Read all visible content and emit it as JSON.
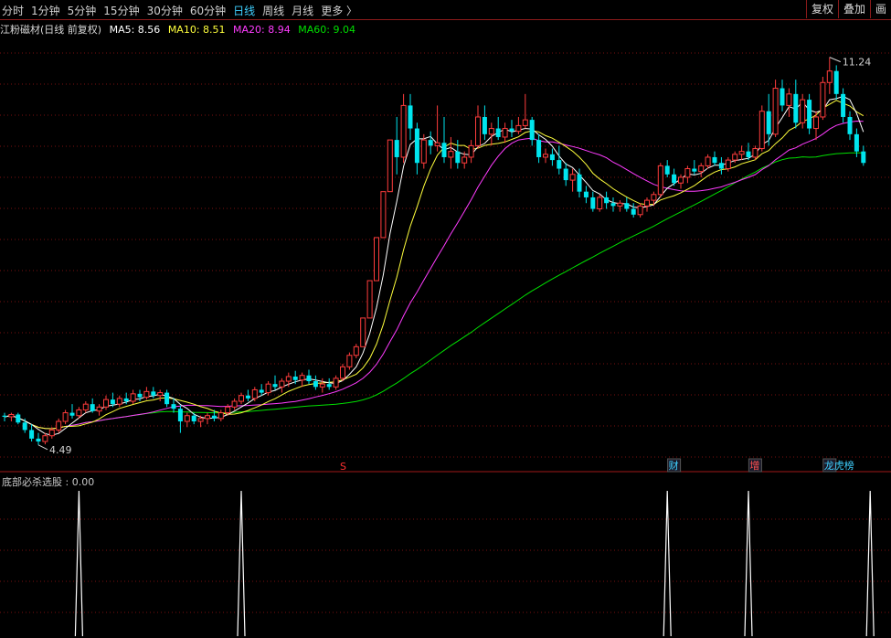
{
  "toolbar": {
    "periods": [
      {
        "label": "分时",
        "active": false
      },
      {
        "label": "1分钟",
        "active": false
      },
      {
        "label": "5分钟",
        "active": false
      },
      {
        "label": "15分钟",
        "active": false
      },
      {
        "label": "30分钟",
        "active": false
      },
      {
        "label": "60分钟",
        "active": false
      },
      {
        "label": "日线",
        "active": true
      },
      {
        "label": "周线",
        "active": false
      },
      {
        "label": "月线",
        "active": false
      },
      {
        "label": "更多 〉",
        "active": false
      }
    ],
    "right_buttons": [
      "复权",
      "叠加",
      "画"
    ]
  },
  "info": {
    "title": "江粉磁材(日线 前复权)",
    "ma5": "MA5: 8.56",
    "ma10": "MA10: 8.51",
    "ma20": "MA20: 8.94",
    "ma60": "MA60: 9.04"
  },
  "colors": {
    "up": "#ff3c3c",
    "down": "#00e5ee",
    "ma5": "#ffffff",
    "ma10": "#ffff3c",
    "ma20": "#ff3cff",
    "ma60": "#00e000",
    "grid": "#7a1010",
    "accent": "#3fd0ff"
  },
  "indicator": {
    "label": "底部必杀选股 : 0.00",
    "signal_bar_indices": [
      11,
      35,
      98,
      110,
      128
    ]
  },
  "markers": {
    "s_label": "S",
    "cai": "财",
    "zeng": "增",
    "bang": "龙虎榜"
  },
  "chart_data": {
    "type": "candlestick",
    "title": "江粉磁材(日线 前复权)",
    "price_labels": {
      "high": "11.24",
      "low": "4.49"
    },
    "ohlc": [
      [
        5.0,
        5.05,
        4.9,
        4.98
      ],
      [
        4.98,
        5.05,
        4.9,
        5.02
      ],
      [
        5.02,
        5.05,
        4.85,
        4.88
      ],
      [
        4.88,
        4.95,
        4.7,
        4.75
      ],
      [
        4.75,
        4.85,
        4.55,
        4.6
      ],
      [
        4.6,
        4.7,
        4.49,
        4.55
      ],
      [
        4.55,
        4.7,
        4.5,
        4.65
      ],
      [
        4.65,
        4.8,
        4.6,
        4.75
      ],
      [
        4.75,
        4.95,
        4.7,
        4.9
      ],
      [
        4.9,
        5.1,
        4.85,
        5.05
      ],
      [
        5.05,
        5.2,
        4.95,
        5.0
      ],
      [
        5.0,
        5.15,
        4.95,
        5.1
      ],
      [
        5.1,
        5.25,
        5.05,
        5.2
      ],
      [
        5.2,
        5.3,
        5.05,
        5.08
      ],
      [
        5.08,
        5.2,
        5.0,
        5.15
      ],
      [
        5.15,
        5.35,
        5.1,
        5.28
      ],
      [
        5.28,
        5.4,
        5.15,
        5.2
      ],
      [
        5.2,
        5.35,
        5.15,
        5.3
      ],
      [
        5.3,
        5.4,
        5.2,
        5.25
      ],
      [
        5.25,
        5.45,
        5.2,
        5.38
      ],
      [
        5.38,
        5.45,
        5.25,
        5.32
      ],
      [
        5.32,
        5.5,
        5.28,
        5.42
      ],
      [
        5.42,
        5.5,
        5.3,
        5.35
      ],
      [
        5.35,
        5.45,
        5.25,
        5.4
      ],
      [
        5.4,
        5.45,
        5.15,
        5.2
      ],
      [
        5.2,
        5.3,
        5.05,
        5.12
      ],
      [
        5.12,
        5.18,
        4.7,
        4.9
      ],
      [
        4.9,
        5.05,
        4.8,
        5.0
      ],
      [
        5.0,
        5.05,
        4.85,
        4.9
      ],
      [
        4.9,
        5.0,
        4.8,
        4.95
      ],
      [
        4.95,
        5.05,
        4.85,
        5.0
      ],
      [
        5.0,
        5.1,
        4.9,
        4.95
      ],
      [
        4.95,
        5.1,
        4.9,
        5.05
      ],
      [
        5.05,
        5.2,
        5.0,
        5.15
      ],
      [
        5.15,
        5.3,
        5.1,
        5.25
      ],
      [
        5.25,
        5.4,
        5.2,
        5.35
      ],
      [
        5.35,
        5.45,
        5.25,
        5.3
      ],
      [
        5.3,
        5.5,
        5.25,
        5.45
      ],
      [
        5.45,
        5.55,
        5.35,
        5.4
      ],
      [
        5.4,
        5.6,
        5.35,
        5.55
      ],
      [
        5.55,
        5.7,
        5.45,
        5.5
      ],
      [
        5.5,
        5.65,
        5.4,
        5.6
      ],
      [
        5.6,
        5.75,
        5.5,
        5.68
      ],
      [
        5.68,
        5.78,
        5.55,
        5.62
      ],
      [
        5.62,
        5.75,
        5.5,
        5.7
      ],
      [
        5.7,
        5.8,
        5.55,
        5.6
      ],
      [
        5.6,
        5.7,
        5.45,
        5.5
      ],
      [
        5.5,
        5.65,
        5.4,
        5.55
      ],
      [
        5.55,
        5.65,
        5.45,
        5.5
      ],
      [
        5.5,
        5.7,
        5.45,
        5.65
      ],
      [
        5.65,
        5.9,
        5.6,
        5.85
      ],
      [
        5.85,
        6.1,
        5.8,
        6.05
      ],
      [
        6.05,
        6.25,
        6.0,
        6.2
      ],
      [
        6.2,
        6.7,
        6.2,
        6.7
      ],
      [
        6.7,
        7.35,
        6.7,
        7.35
      ],
      [
        7.35,
        8.1,
        7.35,
        8.1
      ],
      [
        8.1,
        8.9,
        8.1,
        8.9
      ],
      [
        8.9,
        9.8,
        8.9,
        9.8
      ],
      [
        9.8,
        10.2,
        9.2,
        9.5
      ],
      [
        9.5,
        10.6,
        9.4,
        10.4
      ],
      [
        10.4,
        10.6,
        9.8,
        10.0
      ],
      [
        10.0,
        10.1,
        9.2,
        9.4
      ],
      [
        9.4,
        9.9,
        9.3,
        9.8
      ],
      [
        9.8,
        9.95,
        9.55,
        9.7
      ],
      [
        9.7,
        10.4,
        9.6,
        9.75
      ],
      [
        9.75,
        10.2,
        9.4,
        9.5
      ],
      [
        9.5,
        9.85,
        9.3,
        9.6
      ],
      [
        9.6,
        9.8,
        9.3,
        9.4
      ],
      [
        9.4,
        9.6,
        9.3,
        9.5
      ],
      [
        9.5,
        9.8,
        9.4,
        9.7
      ],
      [
        9.7,
        10.4,
        9.65,
        10.2
      ],
      [
        10.2,
        10.4,
        9.8,
        9.9
      ],
      [
        9.9,
        10.1,
        9.7,
        10.0
      ],
      [
        10.0,
        10.2,
        9.8,
        9.85
      ],
      [
        9.85,
        10.1,
        9.75,
        10.0
      ],
      [
        10.0,
        10.15,
        9.85,
        9.95
      ],
      [
        9.95,
        10.2,
        9.9,
        10.05
      ],
      [
        10.05,
        10.6,
        10.0,
        10.15
      ],
      [
        10.15,
        10.2,
        9.7,
        9.8
      ],
      [
        9.8,
        9.9,
        9.4,
        9.5
      ],
      [
        9.5,
        9.65,
        9.4,
        9.55
      ],
      [
        9.55,
        9.65,
        9.35,
        9.45
      ],
      [
        9.45,
        9.7,
        9.2,
        9.3
      ],
      [
        9.3,
        9.4,
        9.0,
        9.1
      ],
      [
        9.1,
        9.3,
        8.9,
        9.2
      ],
      [
        9.2,
        9.3,
        8.8,
        8.9
      ],
      [
        8.9,
        9.0,
        8.7,
        8.8
      ],
      [
        8.8,
        8.9,
        8.55,
        8.6
      ],
      [
        8.6,
        8.85,
        8.55,
        8.8
      ],
      [
        8.8,
        8.9,
        8.6,
        8.7
      ],
      [
        8.7,
        8.8,
        8.55,
        8.65
      ],
      [
        8.65,
        8.75,
        8.55,
        8.7
      ],
      [
        8.7,
        8.8,
        8.55,
        8.6
      ],
      [
        8.6,
        8.7,
        8.45,
        8.5
      ],
      [
        8.5,
        8.7,
        8.45,
        8.65
      ],
      [
        8.65,
        8.8,
        8.55,
        8.75
      ],
      [
        8.75,
        8.9,
        8.65,
        8.85
      ],
      [
        8.85,
        9.4,
        8.8,
        9.35
      ],
      [
        9.35,
        9.45,
        9.15,
        9.2
      ],
      [
        9.2,
        9.3,
        9.0,
        9.05
      ],
      [
        9.05,
        9.2,
        8.95,
        9.15
      ],
      [
        9.15,
        9.35,
        9.05,
        9.3
      ],
      [
        9.3,
        9.45,
        9.2,
        9.25
      ],
      [
        9.25,
        9.4,
        9.15,
        9.35
      ],
      [
        9.35,
        9.55,
        9.3,
        9.5
      ],
      [
        9.5,
        9.6,
        9.35,
        9.4
      ],
      [
        9.4,
        9.5,
        9.2,
        9.3
      ],
      [
        9.3,
        9.5,
        9.25,
        9.45
      ],
      [
        9.45,
        9.6,
        9.4,
        9.55
      ],
      [
        9.55,
        9.7,
        9.45,
        9.6
      ],
      [
        9.6,
        9.75,
        9.45,
        9.5
      ],
      [
        9.5,
        9.7,
        9.45,
        9.65
      ],
      [
        9.65,
        10.4,
        9.6,
        10.3
      ],
      [
        10.3,
        10.6,
        9.7,
        9.9
      ],
      [
        9.9,
        10.85,
        9.85,
        10.7
      ],
      [
        10.7,
        10.85,
        10.3,
        10.4
      ],
      [
        10.4,
        10.7,
        10.2,
        10.6
      ],
      [
        10.6,
        10.85,
        10.0,
        10.1
      ],
      [
        10.1,
        10.6,
        10.0,
        10.5
      ],
      [
        10.5,
        10.6,
        9.9,
        10.0
      ],
      [
        10.0,
        10.3,
        9.8,
        10.2
      ],
      [
        10.2,
        10.9,
        10.15,
        10.8
      ],
      [
        10.8,
        11.24,
        10.6,
        11.0
      ],
      [
        11.0,
        11.1,
        10.5,
        10.6
      ],
      [
        10.6,
        10.7,
        10.1,
        10.2
      ],
      [
        10.2,
        10.3,
        9.8,
        9.9
      ],
      [
        9.9,
        10.0,
        9.5,
        9.6
      ],
      [
        9.6,
        9.7,
        9.35,
        9.4
      ]
    ]
  }
}
